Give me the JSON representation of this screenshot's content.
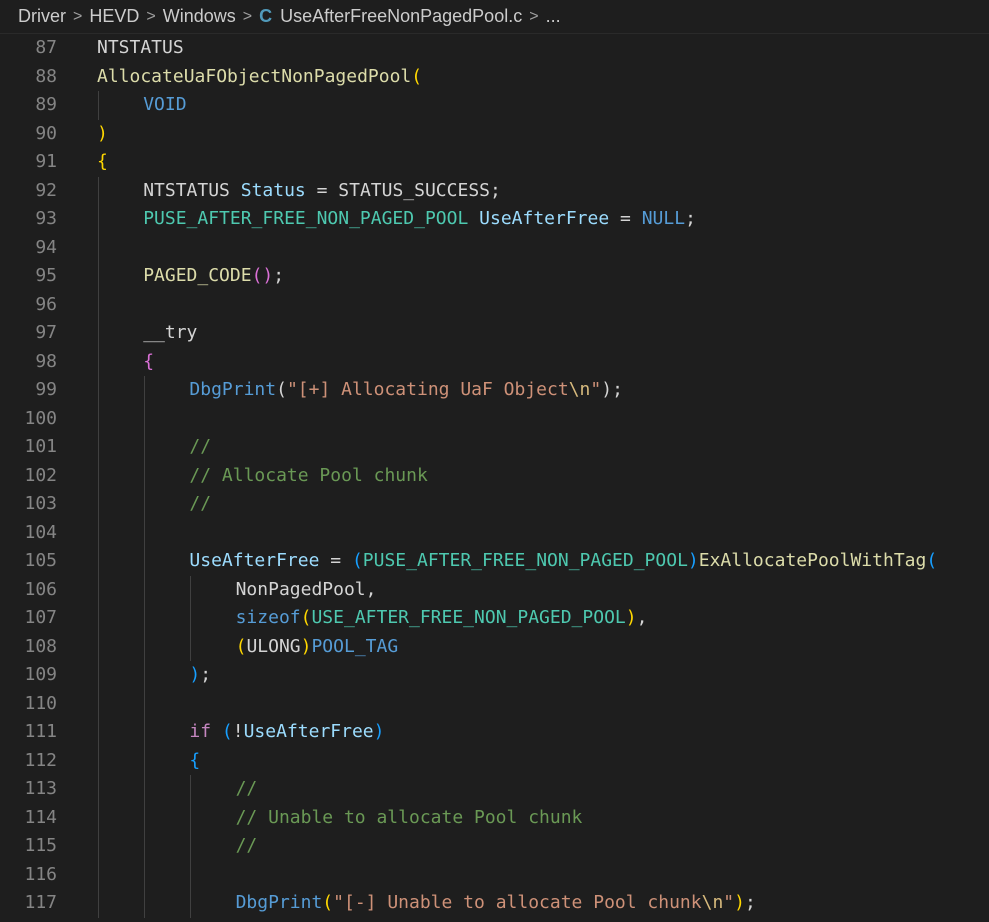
{
  "breadcrumb": {
    "items": [
      "Driver",
      "HEVD",
      "Windows",
      "UseAfterFreeNonPagedPool.c",
      "..."
    ],
    "file_icon": "c-file-icon"
  },
  "colors": {
    "background": "#1e1e1e",
    "line_number": "#858585",
    "function": "#dcdcaa",
    "type": "#4ec9b0",
    "variable": "#9cdcfe",
    "keyword": "#569cd6",
    "control": "#c586c0",
    "string": "#ce9178",
    "comment": "#6a9955"
  },
  "editor": {
    "lines": [
      {
        "n": "87",
        "indent": 0,
        "tokens": [
          [
            "NTSTATUS",
            "plain"
          ]
        ]
      },
      {
        "n": "88",
        "indent": 0,
        "tokens": [
          [
            "AllocateUaFObjectNonPagedPool",
            "macro"
          ],
          [
            "(",
            "br1"
          ]
        ]
      },
      {
        "n": "89",
        "indent": 1,
        "tokens": [
          [
            "VOID",
            "kw"
          ]
        ]
      },
      {
        "n": "90",
        "indent": 0,
        "tokens": [
          [
            ")",
            "br1"
          ]
        ]
      },
      {
        "n": "91",
        "indent": 0,
        "tokens": [
          [
            "{",
            "br1"
          ]
        ]
      },
      {
        "n": "92",
        "indent": 1,
        "tokens": [
          [
            "NTSTATUS ",
            "plain"
          ],
          [
            "Status",
            "var"
          ],
          [
            " = STATUS_SUCCESS;",
            "plain"
          ]
        ]
      },
      {
        "n": "93",
        "indent": 1,
        "tokens": [
          [
            "PUSE_AFTER_FREE_NON_PAGED_POOL",
            "type"
          ],
          [
            " ",
            "plain"
          ],
          [
            "UseAfterFree",
            "var"
          ],
          [
            " = ",
            "plain"
          ],
          [
            "NULL",
            "kw"
          ],
          [
            ";",
            "plain"
          ]
        ]
      },
      {
        "n": "94",
        "indent": 1,
        "tokens": []
      },
      {
        "n": "95",
        "indent": 1,
        "tokens": [
          [
            "PAGED_CODE",
            "macro"
          ],
          [
            "()",
            "br2"
          ],
          [
            ";",
            "plain"
          ]
        ]
      },
      {
        "n": "96",
        "indent": 1,
        "tokens": []
      },
      {
        "n": "97",
        "indent": 1,
        "tokens": [
          [
            "__try",
            "plain"
          ]
        ]
      },
      {
        "n": "98",
        "indent": 1,
        "tokens": [
          [
            "{",
            "br2"
          ]
        ]
      },
      {
        "n": "99",
        "indent": 2,
        "tokens": [
          [
            "DbgPrint",
            "kw"
          ],
          [
            "(",
            "plain"
          ],
          [
            "\"[+] Allocating UaF Object",
            "str"
          ],
          [
            "\\n",
            "esc"
          ],
          [
            "\"",
            "str"
          ],
          [
            ");",
            "plain"
          ]
        ]
      },
      {
        "n": "100",
        "indent": 2,
        "tokens": []
      },
      {
        "n": "101",
        "indent": 2,
        "tokens": [
          [
            "//",
            "com"
          ]
        ]
      },
      {
        "n": "102",
        "indent": 2,
        "tokens": [
          [
            "// Allocate Pool chunk",
            "com"
          ]
        ]
      },
      {
        "n": "103",
        "indent": 2,
        "tokens": [
          [
            "//",
            "com"
          ]
        ]
      },
      {
        "n": "104",
        "indent": 2,
        "tokens": []
      },
      {
        "n": "105",
        "indent": 2,
        "tokens": [
          [
            "UseAfterFree",
            "var"
          ],
          [
            " = ",
            "plain"
          ],
          [
            "(",
            "br3"
          ],
          [
            "PUSE_AFTER_FREE_NON_PAGED_POOL",
            "type"
          ],
          [
            ")",
            "br3"
          ],
          [
            "ExAllocatePoolWithTag",
            "macro"
          ],
          [
            "(",
            "br3"
          ]
        ]
      },
      {
        "n": "106",
        "indent": 3,
        "tokens": [
          [
            "NonPagedPool,",
            "plain"
          ]
        ]
      },
      {
        "n": "107",
        "indent": 3,
        "tokens": [
          [
            "sizeof",
            "kw"
          ],
          [
            "(",
            "br1"
          ],
          [
            "USE_AFTER_FREE_NON_PAGED_POOL",
            "type"
          ],
          [
            ")",
            "br1"
          ],
          [
            ",",
            "plain"
          ]
        ]
      },
      {
        "n": "108",
        "indent": 3,
        "tokens": [
          [
            "(",
            "br1"
          ],
          [
            "ULONG",
            "plain"
          ],
          [
            ")",
            "br1"
          ],
          [
            "POOL_TAG",
            "kw"
          ]
        ]
      },
      {
        "n": "109",
        "indent": 2,
        "tokens": [
          [
            ")",
            "br3"
          ],
          [
            ";",
            "plain"
          ]
        ]
      },
      {
        "n": "110",
        "indent": 2,
        "tokens": []
      },
      {
        "n": "111",
        "indent": 2,
        "tokens": [
          [
            "if ",
            "ctrl"
          ],
          [
            "(",
            "br3"
          ],
          [
            "!",
            "plain"
          ],
          [
            "UseAfterFree",
            "var"
          ],
          [
            ")",
            "br3"
          ]
        ]
      },
      {
        "n": "112",
        "indent": 2,
        "tokens": [
          [
            "{",
            "br3"
          ]
        ]
      },
      {
        "n": "113",
        "indent": 3,
        "tokens": [
          [
            "//",
            "com"
          ]
        ]
      },
      {
        "n": "114",
        "indent": 3,
        "tokens": [
          [
            "// Unable to allocate Pool chunk",
            "com"
          ]
        ]
      },
      {
        "n": "115",
        "indent": 3,
        "tokens": [
          [
            "//",
            "com"
          ]
        ]
      },
      {
        "n": "116",
        "indent": 3,
        "tokens": []
      },
      {
        "n": "117",
        "indent": 3,
        "tokens": [
          [
            "DbgPrint",
            "kw"
          ],
          [
            "(",
            "br1"
          ],
          [
            "\"[-] Unable to allocate Pool chunk",
            "str"
          ],
          [
            "\\n",
            "esc"
          ],
          [
            "\"",
            "str"
          ],
          [
            ")",
            "br1"
          ],
          [
            ";",
            "plain"
          ]
        ]
      }
    ]
  }
}
